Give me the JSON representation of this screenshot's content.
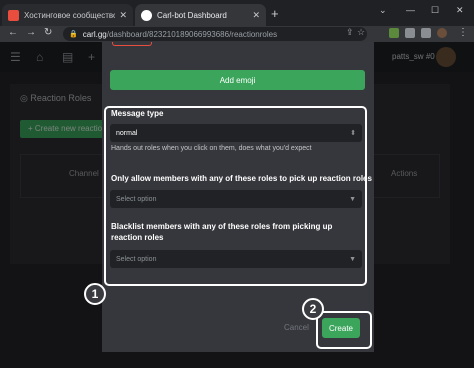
{
  "browser": {
    "tabs": [
      {
        "title": "Хостинговое сообщество «Time»",
        "close": "✕"
      },
      {
        "title": "Carl-bot Dashboard",
        "close": "✕"
      }
    ],
    "new_tab": "+",
    "window_controls": {
      "tabs_menu": "⌄",
      "minimize": "—",
      "maximize": "☐",
      "close": "✕"
    },
    "nav": {
      "back": "←",
      "forward": "→",
      "reload": "↻"
    },
    "url_host": "carl.gg",
    "url_path": "/dashboard/823210189066993686/reactionroles"
  },
  "app": {
    "username": "patts_sw",
    "user_tag": "#0",
    "section_title": "Reaction Roles",
    "create_button": "Create new reaction",
    "table_headers": [
      "Channel",
      "Actions"
    ]
  },
  "modal": {
    "add_emoji": "Add emoji",
    "message_type_label": "Message type",
    "message_type_value": "normal",
    "message_type_hint": "Hands out roles when you click on them, does what you'd expect",
    "allow_label": "Only allow members with any of these roles to pick up reaction roles",
    "allow_placeholder": "Select option",
    "blacklist_label_1": "Blacklist members with any of these roles from picking up",
    "blacklist_label_2": "reaction roles",
    "blacklist_placeholder": "Select option",
    "cancel": "Cancel",
    "create": "Create"
  },
  "annotations": {
    "badge1": "1",
    "badge2": "2"
  },
  "icons": [
    "back-icon",
    "forward-icon",
    "reload-icon",
    "lock-icon",
    "share-icon",
    "star-icon",
    "menu-icon",
    "home-icon",
    "book-icon",
    "plus-icon",
    "caret-icon"
  ],
  "colors": {
    "accent_green": "#3ba55c",
    "modal_bg": "#36373c",
    "highlight": "#ffffff"
  }
}
